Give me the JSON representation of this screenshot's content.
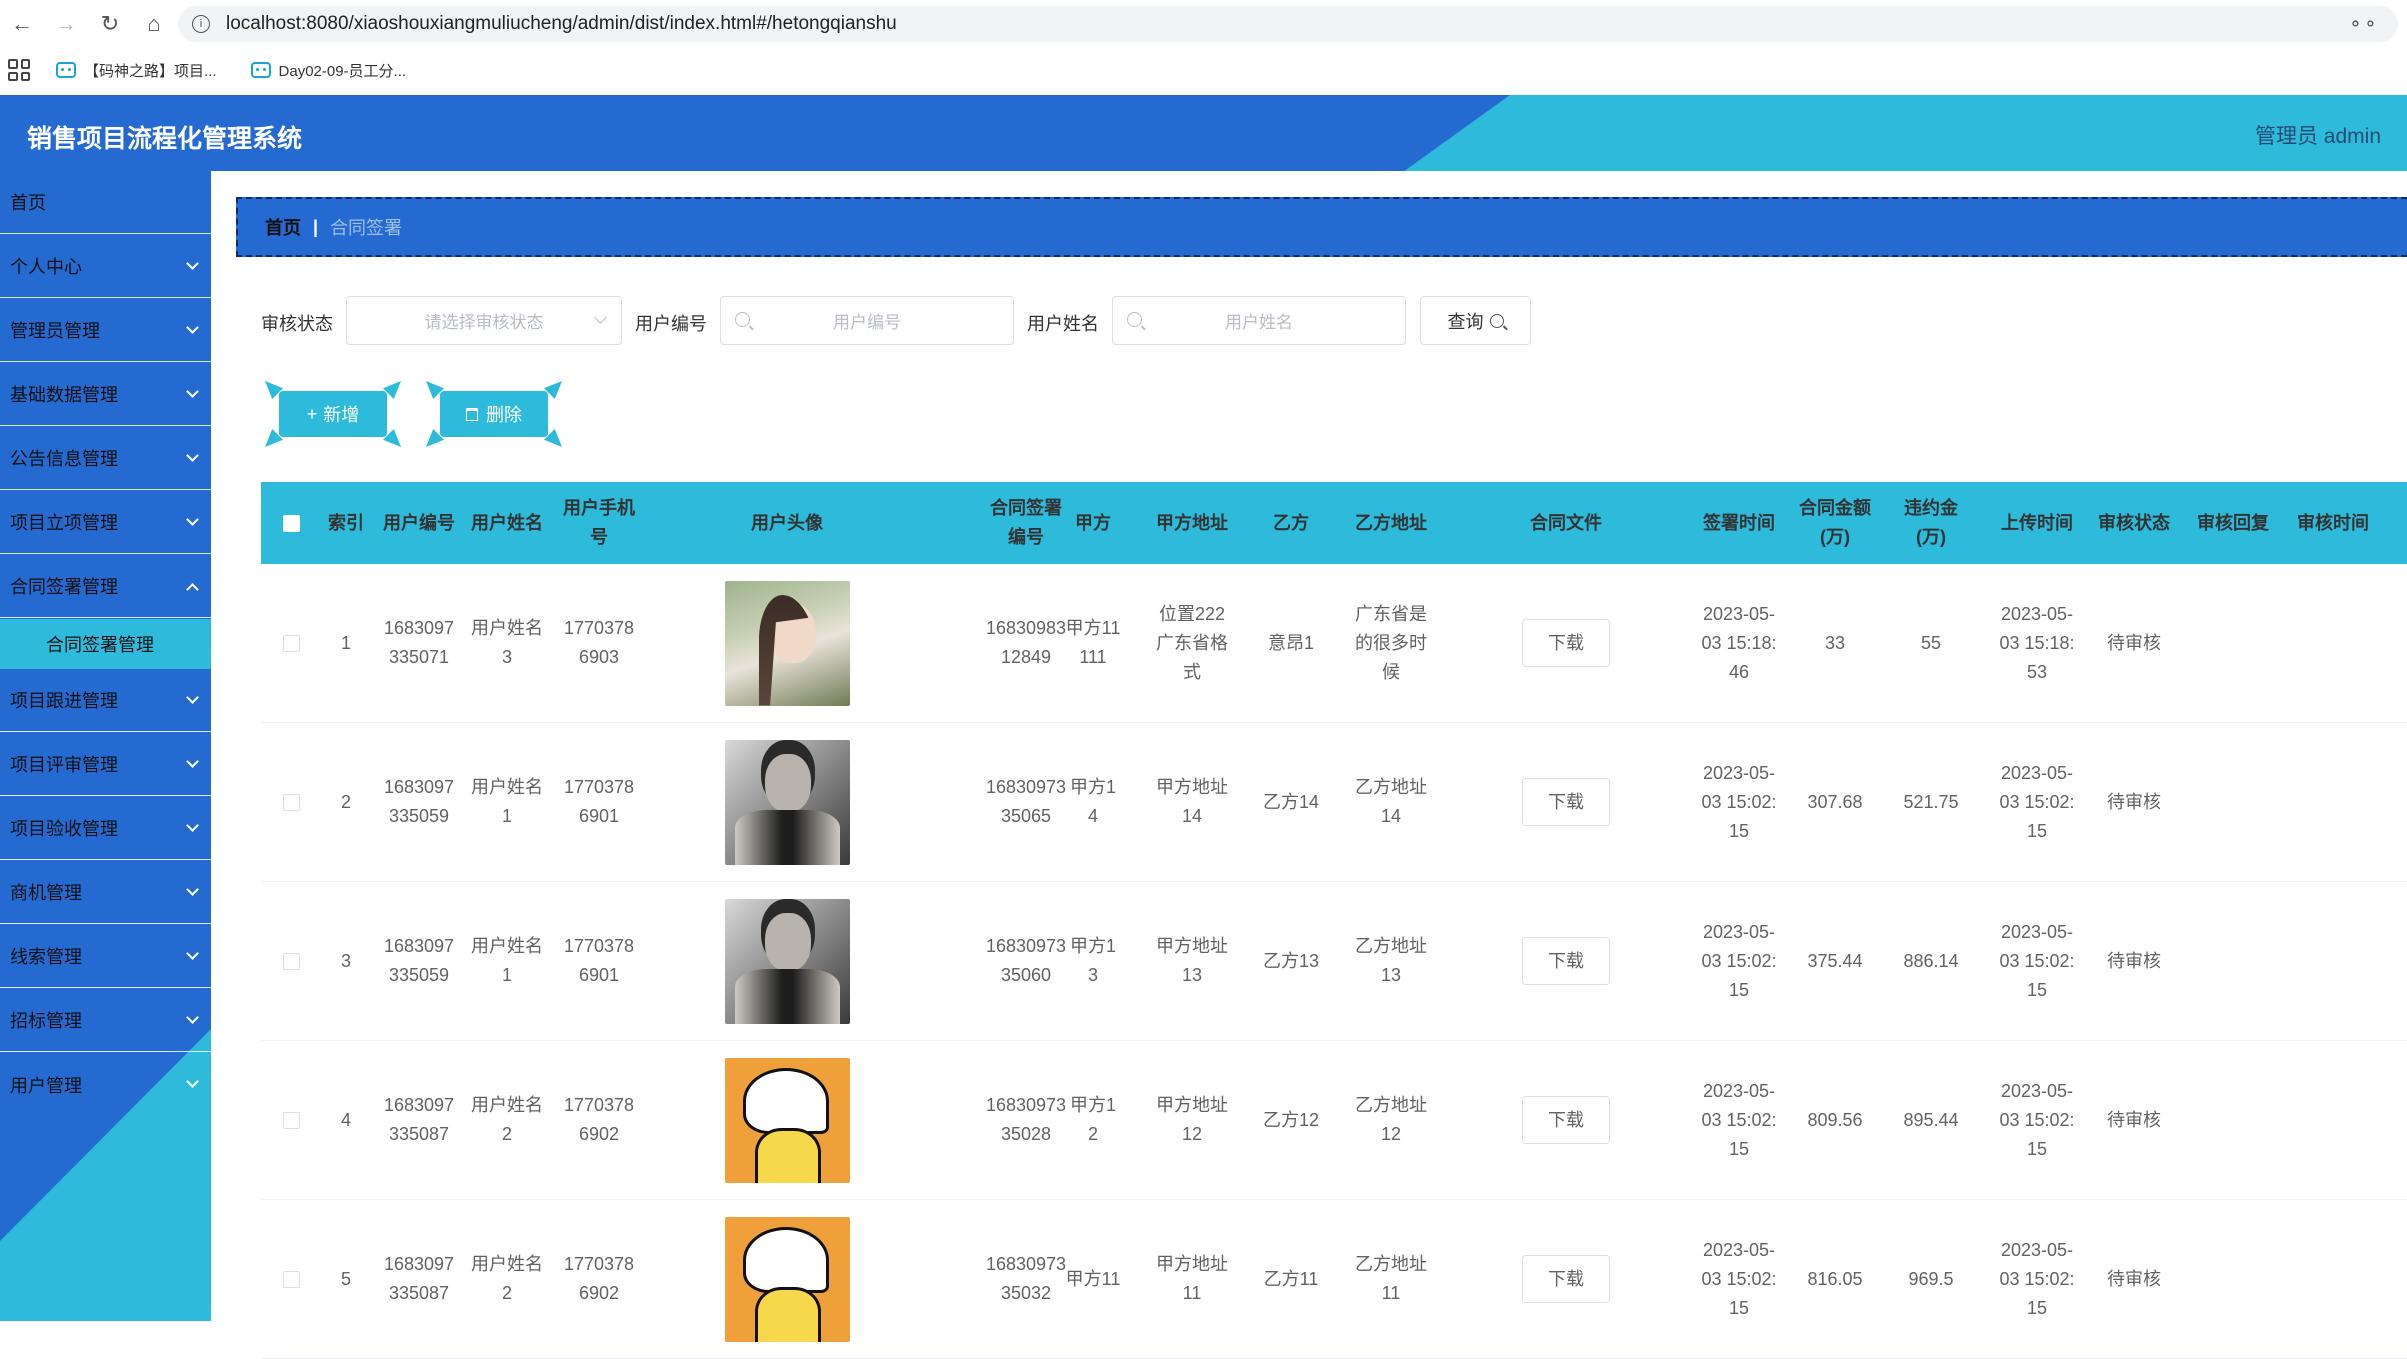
{
  "browser": {
    "url": "localhost:8080/xiaoshouxiangmuliucheng/admin/dist/index.html#/hetongqianshu",
    "bookmarks": [
      "【码神之路】项目...",
      "Day02-09-员工分..."
    ]
  },
  "header": {
    "title": "销售项目流程化管理系统",
    "user": "管理员 admin"
  },
  "sidebar": {
    "items": [
      {
        "label": "首页",
        "has_children": false
      },
      {
        "label": "个人中心",
        "has_children": true
      },
      {
        "label": "管理员管理",
        "has_children": true
      },
      {
        "label": "基础数据管理",
        "has_children": true
      },
      {
        "label": "公告信息管理",
        "has_children": true
      },
      {
        "label": "项目立项管理",
        "has_children": true
      },
      {
        "label": "合同签署管理",
        "has_children": true,
        "open": true
      }
    ],
    "active_sub": "合同签署管理",
    "items_after": [
      {
        "label": "项目跟进管理"
      },
      {
        "label": "项目评审管理"
      },
      {
        "label": "项目验收管理"
      },
      {
        "label": "商机管理"
      },
      {
        "label": "线索管理"
      },
      {
        "label": "招标管理"
      },
      {
        "label": "用户管理"
      }
    ]
  },
  "breadcrumb": {
    "home": "首页",
    "separator": "|",
    "current": "合同签署"
  },
  "search": {
    "status_label": "审核状态",
    "status_placeholder": "请选择审核状态",
    "user_no_label": "用户编号",
    "user_no_placeholder": "用户编号",
    "user_name_label": "用户姓名",
    "user_name_placeholder": "用户姓名",
    "query_button": "查询"
  },
  "actions": {
    "add": "新增",
    "delete": "删除"
  },
  "table": {
    "columns": [
      "索引",
      "用户编号",
      "用户姓名",
      "用户手机号",
      "用户头像",
      "合同签署编号",
      "甲方",
      "甲方地址",
      "乙方",
      "乙方地址",
      "合同文件",
      "签署时间",
      "合同金额(万)",
      "违约金(万)",
      "上传时间",
      "审核状态",
      "审核回复",
      "审核时间"
    ],
    "download_label": "下载",
    "rows": [
      {
        "index": "1",
        "user_no": "1683097335071",
        "user_name": "用户姓名3",
        "phone": "17703786903",
        "avatar": "girl-photo",
        "contract_no": "1683098312849",
        "party_a": "甲方11111",
        "party_a_addr": "位置222广东省格式",
        "party_b": "意昂1",
        "party_b_addr": "广东省是的很多时候",
        "sign_time": "2023-05-03 15:18:46",
        "amount": "33",
        "penalty": "55",
        "upload_time": "2023-05-03 15:18:53",
        "status": "待审核",
        "reply": "",
        "audit_time": ""
      },
      {
        "index": "2",
        "user_no": "1683097335059",
        "user_name": "用户姓名1",
        "phone": "17703786901",
        "avatar": "man-photo",
        "contract_no": "1683097335065",
        "party_a": "甲方14",
        "party_a_addr": "甲方地址14",
        "party_b": "乙方14",
        "party_b_addr": "乙方地址14",
        "sign_time": "2023-05-03 15:02:15",
        "amount": "307.68",
        "penalty": "521.75",
        "upload_time": "2023-05-03 15:02:15",
        "status": "待审核",
        "reply": "",
        "audit_time": ""
      },
      {
        "index": "3",
        "user_no": "1683097335059",
        "user_name": "用户姓名1",
        "phone": "17703786901",
        "avatar": "man-photo",
        "contract_no": "1683097335060",
        "party_a": "甲方13",
        "party_a_addr": "甲方地址13",
        "party_b": "乙方13",
        "party_b_addr": "乙方地址13",
        "sign_time": "2023-05-03 15:02:15",
        "amount": "375.44",
        "penalty": "886.14",
        "upload_time": "2023-05-03 15:02:15",
        "status": "待审核",
        "reply": "",
        "audit_time": ""
      },
      {
        "index": "4",
        "user_no": "1683097335087",
        "user_name": "用户姓名2",
        "phone": "17703786902",
        "avatar": "cartoon",
        "contract_no": "1683097335028",
        "party_a": "甲方12",
        "party_a_addr": "甲方地址12",
        "party_b": "乙方12",
        "party_b_addr": "乙方地址12",
        "sign_time": "2023-05-03 15:02:15",
        "amount": "809.56",
        "penalty": "895.44",
        "upload_time": "2023-05-03 15:02:15",
        "status": "待审核",
        "reply": "",
        "audit_time": ""
      },
      {
        "index": "5",
        "user_no": "1683097335087",
        "user_name": "用户姓名2",
        "phone": "17703786902",
        "avatar": "cartoon",
        "contract_no": "1683097335032",
        "party_a": "甲方11",
        "party_a_addr": "甲方地址11",
        "party_b": "乙方11",
        "party_b_addr": "乙方地址11",
        "sign_time": "2023-05-03 15:02:15",
        "amount": "816.05",
        "penalty": "969.5",
        "upload_time": "2023-05-03 15:02:15",
        "status": "待审核",
        "reply": "",
        "audit_time": ""
      }
    ]
  },
  "colors": {
    "primary_blue": "#256ad1",
    "accent_cyan": "#2ebbdb"
  }
}
